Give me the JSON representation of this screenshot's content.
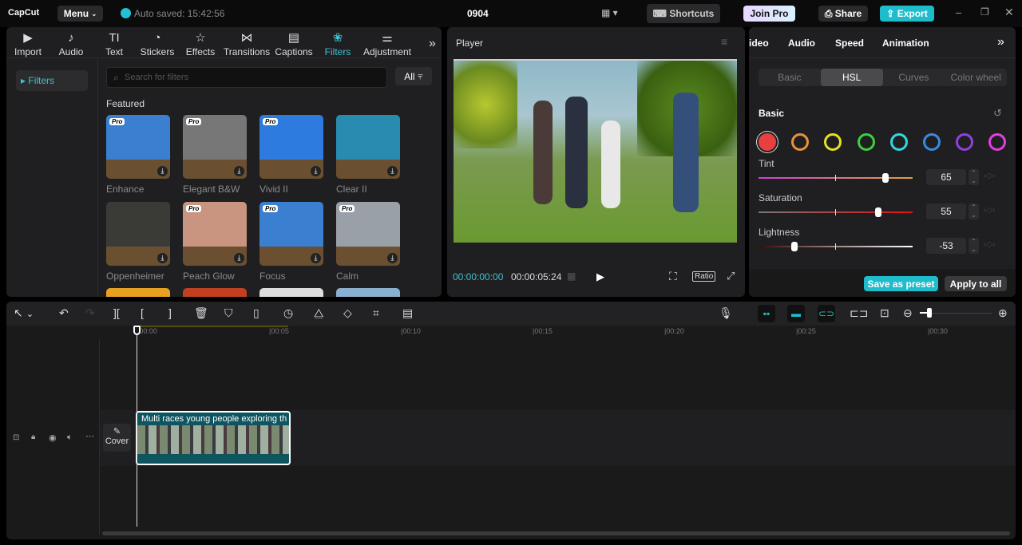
{
  "app": {
    "logo": "CapCut",
    "menu": "Menu",
    "autosave": "Auto saved: 15:42:56",
    "project": "0904",
    "shortcuts": "Shortcuts",
    "join_pro": "Join Pro",
    "share": "Share",
    "export": "Export"
  },
  "left": {
    "tabs": [
      {
        "label": "Import",
        "icon": "▶"
      },
      {
        "label": "Audio",
        "icon": "♪"
      },
      {
        "label": "Text",
        "icon": "TI"
      },
      {
        "label": "Stickers",
        "icon": "◔"
      },
      {
        "label": "Effects",
        "icon": "☆"
      },
      {
        "label": "Transitions",
        "icon": "⋈"
      },
      {
        "label": "Captions",
        "icon": "▤"
      },
      {
        "label": "Filters",
        "icon": "❀"
      },
      {
        "label": "Adjustment",
        "icon": "⚌"
      }
    ],
    "sidebar_item": "Filters",
    "search_placeholder": "Search for filters",
    "all": "All",
    "section": "Featured",
    "filters": [
      {
        "name": "Enhance",
        "pro": "Pro",
        "color": "#3a7fd0"
      },
      {
        "name": "Elegant B&W",
        "pro": "Pro",
        "color": "#777"
      },
      {
        "name": "Vivid II",
        "pro": "Pro",
        "color": "#2e7be0"
      },
      {
        "name": "Clear II",
        "pro": "",
        "color": "#2a8bb0"
      },
      {
        "name": "Oppenheimer",
        "pro": "",
        "color": "#3a3a36"
      },
      {
        "name": "Peach Glow",
        "pro": "Pro",
        "color": "#c99580"
      },
      {
        "name": "Focus",
        "pro": "Pro",
        "color": "#3a7fd0"
      },
      {
        "name": "Calm",
        "pro": "Pro",
        "color": "#9aa0a8"
      }
    ]
  },
  "player": {
    "title": "Player",
    "current": "00:00:00:00",
    "duration": "00:00:05:24",
    "ratio": "Ratio"
  },
  "right": {
    "tabs": [
      "ideo",
      "Audio",
      "Speed",
      "Animation"
    ],
    "subtabs": [
      "Basic",
      "HSL",
      "Curves",
      "Color wheel"
    ],
    "section": "Basic",
    "colors": [
      "#e84040",
      "#e8923a",
      "#e8e020",
      "#3ad040",
      "#30d8e0",
      "#3a8ae0",
      "#9040e0",
      "#e040e0"
    ],
    "sliders": [
      {
        "label": "Tint",
        "value": "65",
        "frac": 0.825
      },
      {
        "label": "Saturation",
        "value": "55",
        "frac": 0.775
      },
      {
        "label": "Lightness",
        "value": "-53",
        "frac": 0.235
      }
    ],
    "save_preset": "Save as preset",
    "apply_all": "Apply to all"
  },
  "timeline": {
    "ticks": [
      "00:00",
      "00:05",
      "00:10",
      "00:15",
      "00:20",
      "00:25",
      "00:30"
    ],
    "cover": "Cover",
    "clip_title": "Multi races young people exploring th"
  }
}
